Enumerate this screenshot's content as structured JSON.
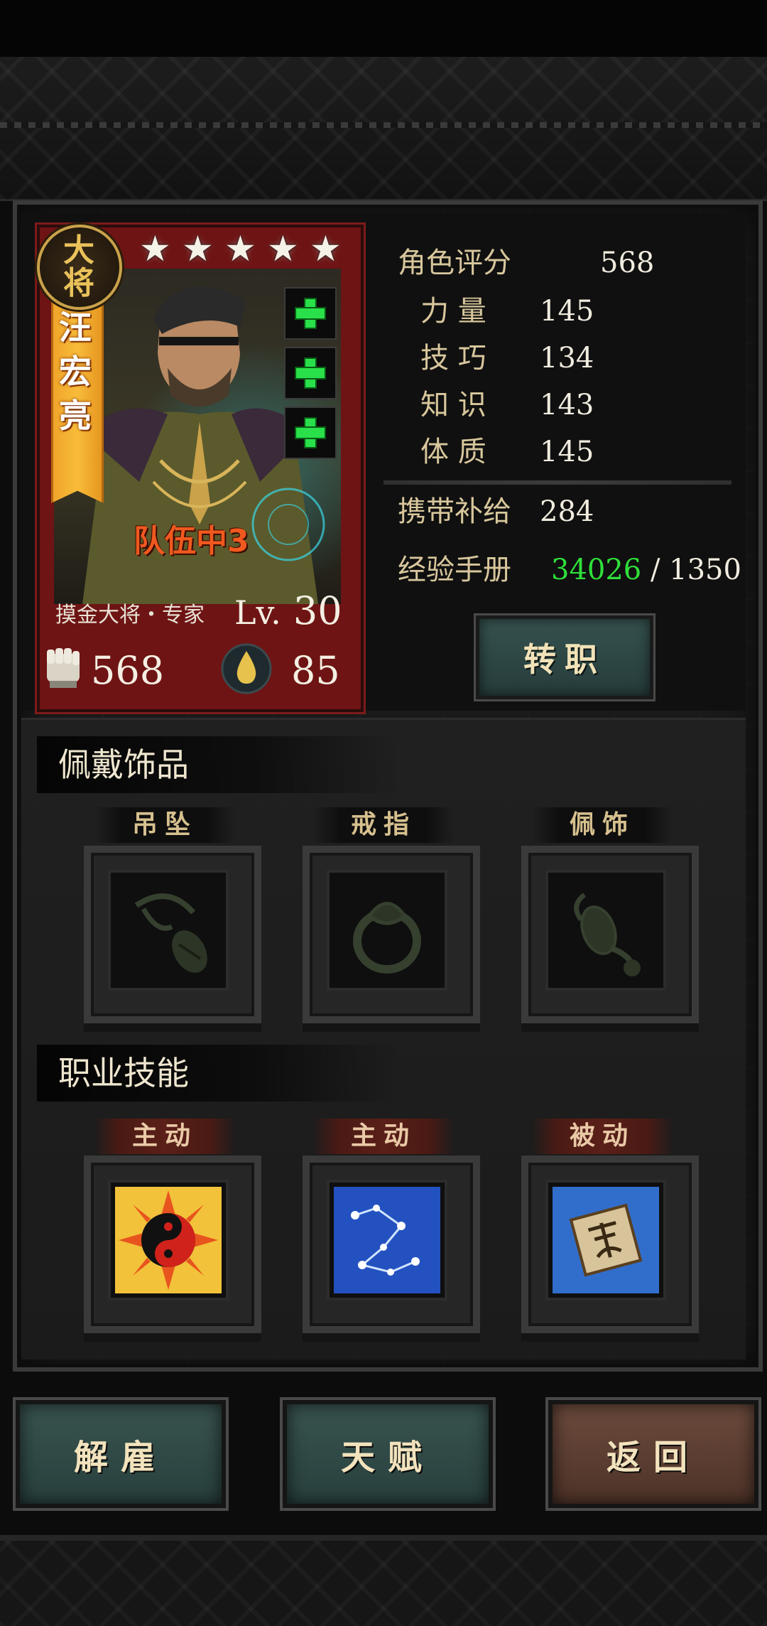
{
  "hero": {
    "rank": "大将",
    "name": "汪宏亮",
    "stars": [
      "★",
      "★",
      "★",
      "★",
      "★"
    ],
    "team_status": "队伍中3",
    "class": "摸金大将・专家",
    "level_prefix": "Lv.",
    "level": "30",
    "power": "568",
    "stress": "85"
  },
  "stats": {
    "score_label": "角色评分",
    "score": "568",
    "strength_label": "力 量",
    "strength": "145",
    "skill_label": "技 巧",
    "skill": "134",
    "knowledge_label": "知 识",
    "knowledge": "143",
    "constitution_label": "体 质",
    "constitution": "145",
    "supplies_label": "携带补给",
    "supplies": "284",
    "exp_label": "经验手册",
    "exp_current": "34026",
    "exp_separator": " / ",
    "exp_required": "1350"
  },
  "transfer_button": "转职",
  "accessories": {
    "title": "佩戴饰品",
    "slots": [
      "吊坠",
      "戒指",
      "佩饰"
    ]
  },
  "skills": {
    "title": "职业技能",
    "slots": [
      "主动",
      "主动",
      "被动"
    ]
  },
  "bottom_buttons": {
    "dismiss": "解雇",
    "talent": "天赋",
    "back": "返回"
  },
  "colors": {
    "card_red": "#6e1414",
    "banner_orange": "#f0a52a",
    "team_text": "#f0591f",
    "exp_green": "#2fe03a",
    "plus_green": "#29e04a",
    "button_teal": "#38534f",
    "button_brown": "#6b4a3c"
  },
  "icons": {
    "stars": "star-icon",
    "equip": "plus-icon",
    "power": "fist-icon",
    "stress": "drop-icon",
    "pendant": "pendant-icon",
    "ring": "ring-icon",
    "trinket": "trinket-icon",
    "skill_1": "yin-yang-icon",
    "skill_2": "constellation-icon",
    "skill_3": "talisman-icon"
  }
}
